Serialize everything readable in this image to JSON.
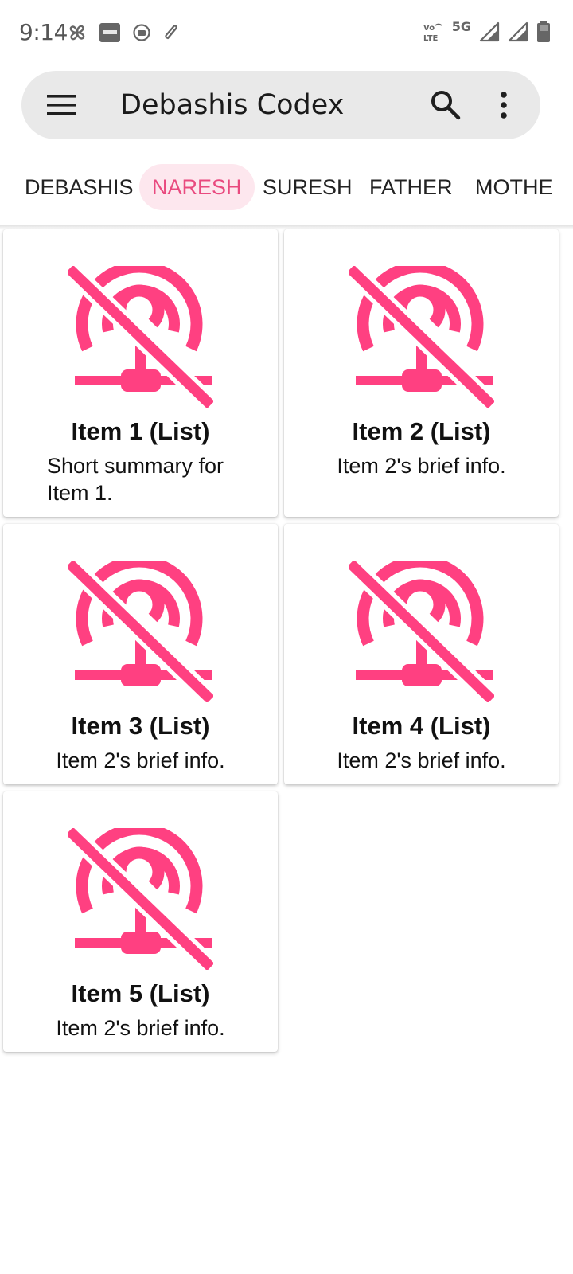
{
  "status_bar": {
    "time": "9:14",
    "left_icons": [
      "pinwheel-icon",
      "paytm-icon",
      "record-icon",
      "paperclip-icon"
    ],
    "right_icons": [
      "volte-icon",
      "5g-icon",
      "signal-icon",
      "signal-icon",
      "battery-icon"
    ],
    "volte_label": "Vo LTE",
    "network_label": "5G"
  },
  "toolbar": {
    "title": "Debashis Codex",
    "menu_icon": "menu-icon",
    "search_icon": "search-icon",
    "more_icon": "more-vert-icon"
  },
  "tabs": [
    {
      "label": "DEBASHIS",
      "active": false
    },
    {
      "label": "NARESH",
      "active": true
    },
    {
      "label": "SURESH",
      "active": false
    },
    {
      "label": "FATHER",
      "active": false
    },
    {
      "label": "MOTHE",
      "active": false
    }
  ],
  "colors": {
    "accent": "#ff4081",
    "tab_active_bg": "#fde7ee",
    "tab_active_text": "#e94a7f",
    "toolbar_bg": "#e9e9e9"
  },
  "items": [
    {
      "title": "Item 1 (List)",
      "summary": "Short summary for Item 1.",
      "icon": "antenna-off-icon"
    },
    {
      "title": "Item 2 (List)",
      "summary": "Item 2's brief info.",
      "icon": "antenna-off-icon"
    },
    {
      "title": "Item 3 (List)",
      "summary": "Item 2's brief info.",
      "icon": "antenna-off-icon"
    },
    {
      "title": "Item 4 (List)",
      "summary": "Item 2's brief info.",
      "icon": "antenna-off-icon"
    },
    {
      "title": "Item 5 (List)",
      "summary": "Item 2's brief info.",
      "icon": "antenna-off-icon"
    }
  ]
}
